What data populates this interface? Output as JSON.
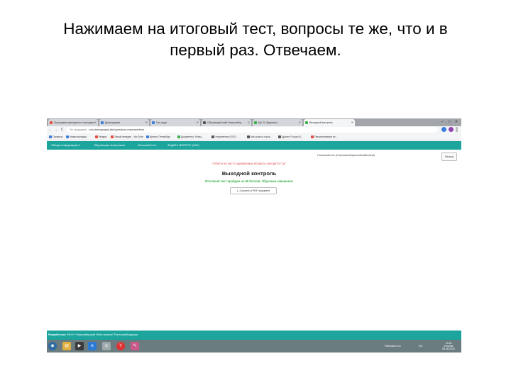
{
  "slide": {
    "title_line1": "Нажимаем на итоговый тест, вопросы те же, что и в",
    "title_line2": "первый раз. Отвечаем."
  },
  "browser": {
    "tabs": [
      {
        "label": "Программа культурного наследия",
        "color": "#e74c3c"
      },
      {
        "label": "Демография",
        "color": "#3b7ddd"
      },
      {
        "label": "Что ищут",
        "color": "#3b7ddd"
      },
      {
        "label": "Обучающий сайт Новосибир...",
        "color": "#555555"
      },
      {
        "label": "My YL Фурсенко",
        "color": "#3cb14a"
      },
      {
        "label": "Выходной контроль",
        "color": "#3cb14a"
      }
    ],
    "active_tab_index": 5,
    "window_controls": {
      "minimize": "–",
      "maximize": "□",
      "close": "✕"
    },
    "nav": {
      "back": "←",
      "forward": "→",
      "reload": "C"
    },
    "address": {
      "security": "Не защищено",
      "url": "edu.demography.site/questions-response/final"
    },
    "bookmarks": [
      {
        "label": "Сервисы",
        "color": "#3b7ddd"
      },
      {
        "label": "Новая вкладка",
        "color": "#3b7ddd"
      },
      {
        "label": "Яндекс",
        "color": "#e74c3c"
      },
      {
        "label": "ЭнциКлопедия - YouTube",
        "color": "#e74c3c"
      },
      {
        "label": "Время: Петербург",
        "color": "#3b7ddd"
      },
      {
        "label": "Документы: Новы...",
        "color": "#3cb14a"
      },
      {
        "label": "Управление (ЕОО...",
        "color": "#555555"
      },
      {
        "label": "Как скрыть строк...",
        "color": "#555555"
      },
      {
        "label": "Другие Я сказ Ю...",
        "color": "#555555"
      },
      {
        "label": "Перспективная по...",
        "color": "#e74c3c"
      }
    ]
  },
  "site": {
    "menu": [
      "Общая информация ▾",
      "Обучающие материалы",
      "Итоговый тест",
      "ЗАДАТЬ ВОПРОС (ЧАТ)"
    ],
    "user": "Пользователь (Соколова Мария Михайловна)",
    "logout": "Выход",
    "answers_link": "Ответы на часто задаваемые вопросы находятся тут",
    "heading": "Выходной контроль",
    "result": "Итоговый тест пройден на 96 баллов. Обучение завершено",
    "pdf_button": "Скачать в PDF формате",
    "footer_label": "Разработчик:",
    "footer_text": "ФБУН \"Новосибирский НИИ гигиены\" Роспотребнадзора"
  },
  "taskbar": {
    "icons": [
      "start-icon",
      "folder-icon",
      "media-player-icon",
      "ie-icon",
      "chrome-icon",
      "yandex-icon",
      "paint-icon"
    ],
    "icon_glyphs": [
      "◉",
      "▤",
      "▶",
      "e",
      "◎",
      "Y",
      "✎"
    ],
    "desktop_label": "Рабочий стол",
    "lang": "RU",
    "time": "13:49",
    "weekday": "вторник",
    "date": "09.06.2020"
  }
}
